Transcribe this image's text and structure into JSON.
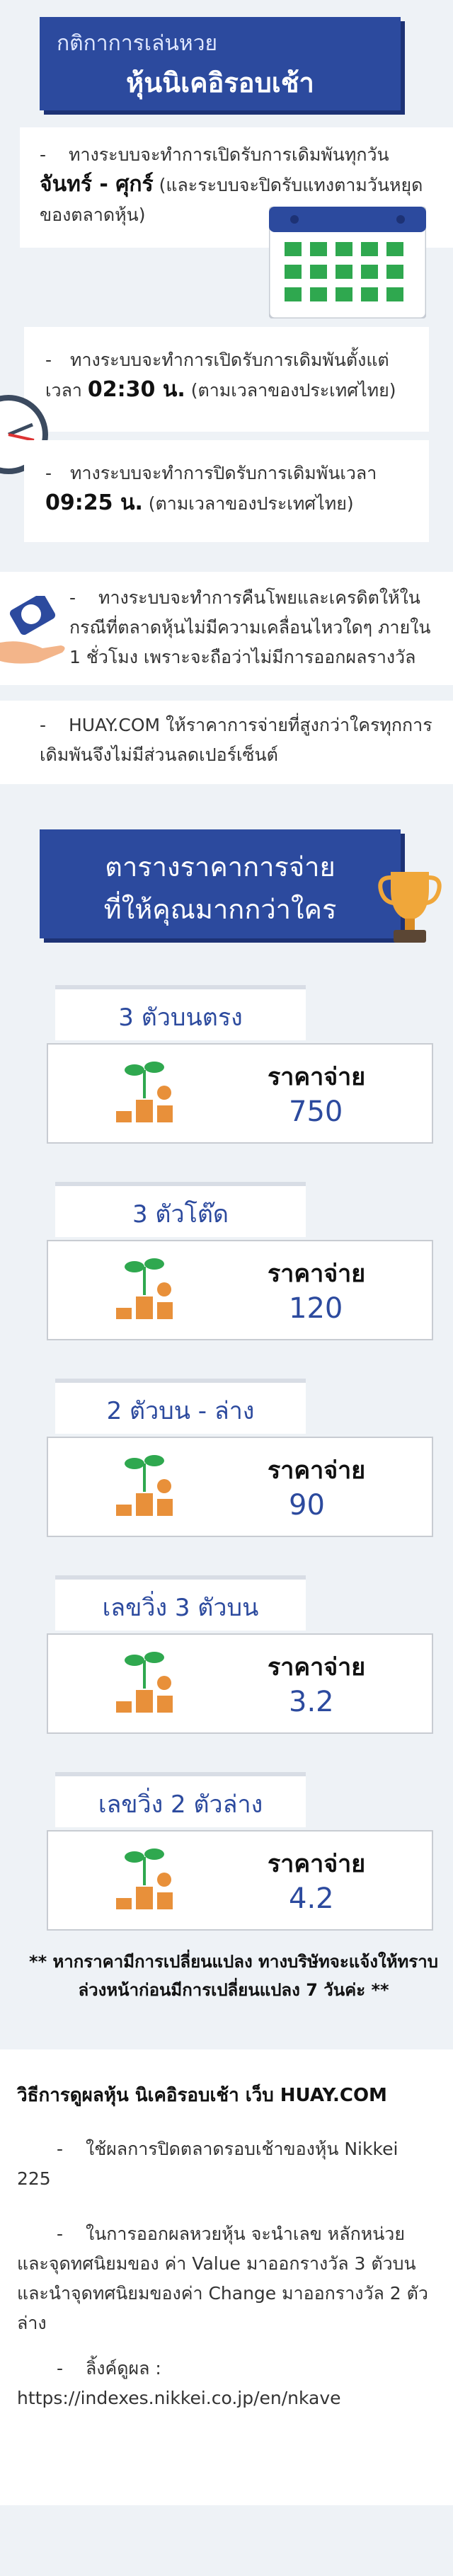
{
  "rules": {
    "subtitle": "กติกาการเล่นหวย",
    "title": "หุ้นนิเคอิรอบเช้า",
    "item1_dash": "-",
    "item1_text": "ทางระบบจะทำการเปิดรับการเดิมพันทุกวัน",
    "item1_bold": "จันทร์ - ศุกร์",
    "item1_text2": "(และระบบจะปิดรับแทงตามวันหยุดของตลาดหุ้น)",
    "item2_text": "ทางระบบจะทำการเปิดรับการเดิมพันตั้งแต่เวลา",
    "item2_bold": "02:30 น.",
    "item2_text2": "(ตามเวลาของประเทศไทย)",
    "item3_text": "ทางระบบจะทำการปิดรับการเดิมพันเวลา",
    "item3_bold": "09:25 น.",
    "item3_text2": "(ตามเวลาของประเทศไทย)",
    "item4_text": "ทางระบบจะทำการคืนโพยและเครดิตให้ในกรณีที่ตลาดหุ้นไม่มีความเคลื่อนไหวใดๆ ภายใน 1 ชั่วโมง เพราะจะถือว่าไม่มีการออกผลรางวัล",
    "item5_text": "HUAY.COM ให้ราคาการจ่ายที่สูงกว่าใครทุกการเดิมพันจึงไม่มีส่วนลดเปอร์เซ็นต์"
  },
  "payout": {
    "title_line1": "ตารางราคาการจ่าย",
    "title_line2": "ที่ให้คุณมากกว่าใคร",
    "price_label": "ราคาจ่าย",
    "items": [
      {
        "name": "3 ตัวบนตรง",
        "value": "750"
      },
      {
        "name": "3 ตัวโต๊ด",
        "value": "120"
      },
      {
        "name": "2 ตัวบน - ล่าง",
        "value": "90"
      },
      {
        "name": "เลขวิ่ง 3 ตัวบน",
        "value": "3.2"
      },
      {
        "name": "เลขวิ่ง 2 ตัวล่าง",
        "value": "4.2"
      }
    ],
    "note": "** หากราคามีการเปลี่ยนแปลง ทางบริษัทจะแจ้งให้ทราบล่วงหน้าก่อนมีการเปลี่ยนแปลง 7 วันค่ะ **"
  },
  "howto": {
    "title": "วิธีการดูผลหุ้น นิเคอิรอบเช้า เว็บ HUAY.COM",
    "item1": "ใช้ผลการปิดตลาดรอบเช้าของหุ้น Nikkei 225",
    "item2": "ในการออกผลหวยหุ้น จะนำเลข หลักหน่วยและจุดทศนิยมของ ค่า Value มาออกรางวัล 3 ตัวบน และนำจุดทศนิยมของค่า Change มาออกรางวัล 2 ตัวล่าง",
    "item3": "ลิ้งค์ดูผล : https://indexes.nikkei.co.jp/en/nkave"
  },
  "colors": {
    "brand": "#2c4a9e",
    "gold": "#f0a73a",
    "green": "#2fa84f",
    "orange": "#e8903a"
  },
  "icons": [
    "calendar-icon",
    "clock-icon",
    "refund-hand-icon",
    "trophy-icon",
    "money-plant-icon"
  ]
}
